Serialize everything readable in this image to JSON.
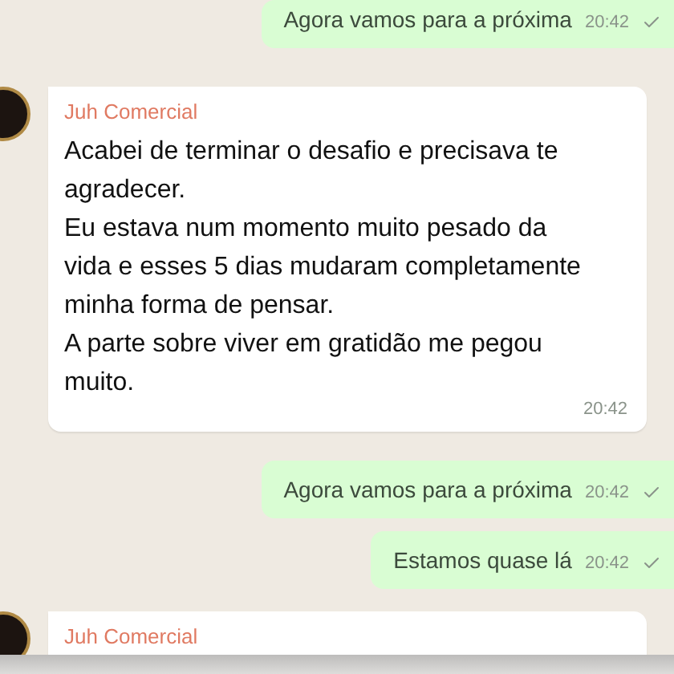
{
  "messages": [
    {
      "kind": "out",
      "text": "Agora vamos para a próxima",
      "time": "20:42",
      "delivered": true
    },
    {
      "kind": "in",
      "sender": "Juh Comercial",
      "paragraphs": [
        "Acabei de terminar o desafio e precisava te agradecer.",
        "Eu estava num momento muito pesado da vida e esses 5 dias mudaram completamente minha forma de pensar.",
        "A parte sobre viver em gratidão me pegou muito."
      ],
      "time": "20:42"
    },
    {
      "kind": "out",
      "text": "Agora vamos para a próxima",
      "time": "20:42",
      "delivered": true
    },
    {
      "kind": "out",
      "text": "Estamos quase lá",
      "time": "20:42",
      "delivered": true
    },
    {
      "kind": "in",
      "sender": "Juh Comercial"
    }
  ]
}
